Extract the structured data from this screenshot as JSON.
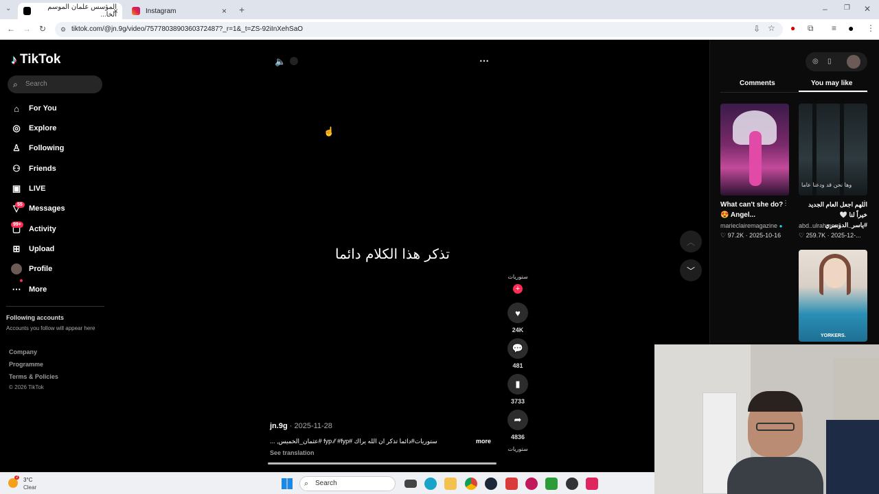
{
  "browser": {
    "tabs": [
      {
        "title": "المؤسس علمان الموسم الخا...",
        "active": true
      },
      {
        "title": "Instagram",
        "active": false
      }
    ],
    "url": "tiktok.com/@jn.9g/video/7577803890360372487?_r=1&_t=ZS-92iInXehSaO"
  },
  "sidebar": {
    "logo": "TikTok",
    "search_placeholder": "Search",
    "nav": [
      {
        "label": "For You",
        "icon": "home-icon"
      },
      {
        "label": "Explore",
        "icon": "compass-icon"
      },
      {
        "label": "Following",
        "icon": "following-icon"
      },
      {
        "label": "Friends",
        "icon": "friends-icon"
      },
      {
        "label": "LIVE",
        "icon": "live-icon"
      },
      {
        "label": "Messages",
        "icon": "messages-icon",
        "badge": "55"
      },
      {
        "label": "Activity",
        "icon": "activity-icon",
        "badge": "99+"
      },
      {
        "label": "Upload",
        "icon": "upload-icon"
      },
      {
        "label": "Profile",
        "icon": "avatar"
      },
      {
        "label": "More",
        "icon": "more-icon"
      }
    ],
    "following_title": "Following accounts",
    "following_sub": "Accounts you follow will appear here",
    "footer": [
      "Company",
      "Programme",
      "Terms & Policies",
      "© 2026 TikTok"
    ]
  },
  "video": {
    "caption": "تذكر هذا الكلام دائما",
    "author": "jn.9g",
    "date": "2025-11-28",
    "description": "ستوريات#دائما تذكر ان الله يراك #fyp ⁄⁄ #fyp #عثمان_الخميس, ...",
    "more_label": "more",
    "see_translation": "See translation",
    "progress": 1.0,
    "avatar_text": "ستوريات",
    "music_text": "ستوريات",
    "actions": {
      "likes": "24K",
      "comments": "481",
      "saves": "3733",
      "shares": "4836"
    }
  },
  "right_panel": {
    "tabs": [
      "Comments",
      "You may like"
    ],
    "active_tab": "You may like",
    "videos": [
      {
        "title": "What can't she do? 😍 Angel...",
        "user": "marieclairemagazine",
        "verified": true,
        "likes": "97.2K",
        "date": "2025-10-16"
      },
      {
        "title": "اللهم اجعل العام الجديد خيراً لنا 🤍 #ياسر_الدوسري",
        "user": "abd..ulrahman1",
        "verified": false,
        "likes": "259.7K",
        "date": "2025-12-..."
      },
      {
        "thumb_text": "YORKERS."
      }
    ]
  },
  "taskbar": {
    "temperature": "3°C",
    "condition": "Clear",
    "search_placeholder": "Search",
    "weather_badge": "2"
  },
  "colors": {
    "accent": "#fe2c55",
    "background": "#000000",
    "panel": "#0b0b0b"
  }
}
